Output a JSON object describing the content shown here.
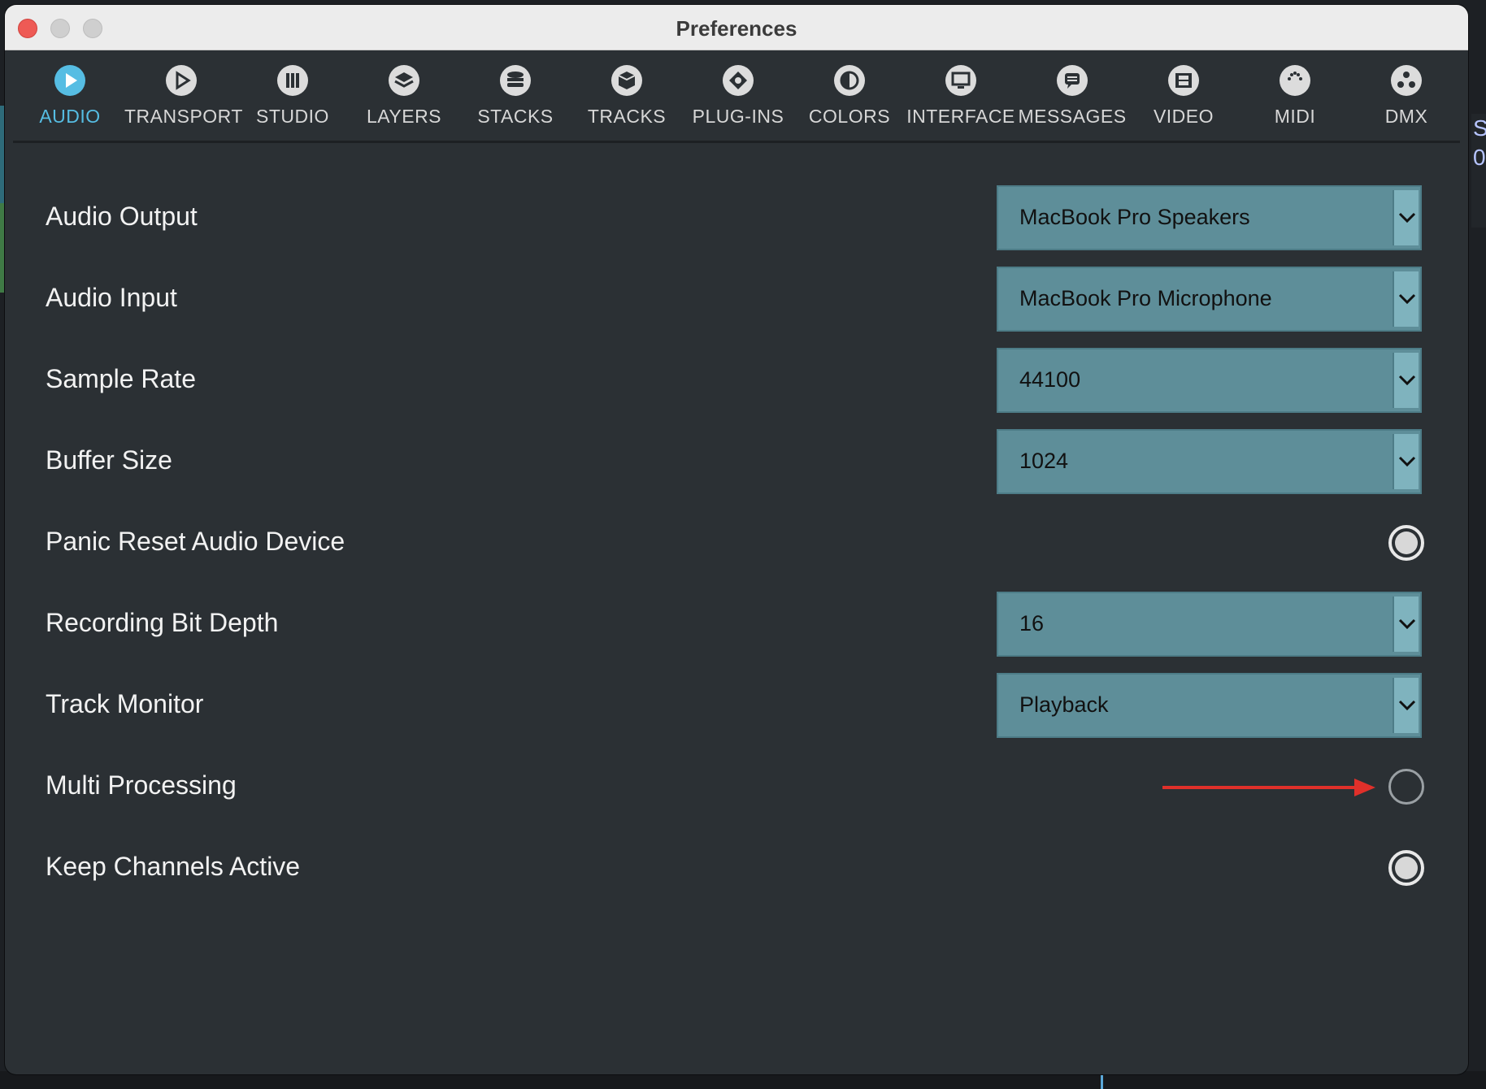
{
  "window": {
    "title": "Preferences"
  },
  "background": {
    "right_char_1": "S",
    "right_char_2": "0"
  },
  "tabs": [
    {
      "label": "AUDIO",
      "icon": "play-icon",
      "active": true
    },
    {
      "label": "TRANSPORT",
      "icon": "play-outline-icon"
    },
    {
      "label": "STUDIO",
      "icon": "piano-icon"
    },
    {
      "label": "LAYERS",
      "icon": "layers-icon"
    },
    {
      "label": "STACKS",
      "icon": "stack-icon"
    },
    {
      "label": "TRACKS",
      "icon": "cube-icon"
    },
    {
      "label": "PLUG-INS",
      "icon": "plug-icon"
    },
    {
      "label": "COLORS",
      "icon": "contrast-icon"
    },
    {
      "label": "INTERFACE",
      "icon": "monitor-icon"
    },
    {
      "label": "MESSAGES",
      "icon": "chat-icon"
    },
    {
      "label": "VIDEO",
      "icon": "film-icon"
    },
    {
      "label": "MIDI",
      "icon": "midi-icon"
    },
    {
      "label": "DMX",
      "icon": "dmx-icon"
    }
  ],
  "settings": [
    {
      "label": "Audio Output",
      "type": "select",
      "value": "MacBook Pro Speakers"
    },
    {
      "label": "Audio Input",
      "type": "select",
      "value": "MacBook Pro Microphone"
    },
    {
      "label": "Sample Rate",
      "type": "select",
      "value": "44100"
    },
    {
      "label": "Buffer Size",
      "type": "select",
      "value": "1024"
    },
    {
      "label": "Panic Reset Audio Device",
      "type": "radio",
      "checked": true
    },
    {
      "label": "Recording Bit Depth",
      "type": "select",
      "value": "16"
    },
    {
      "label": "Track Monitor",
      "type": "select",
      "value": "Playback"
    },
    {
      "label": "Multi Processing",
      "type": "radio",
      "checked": false,
      "annotation": "red-arrow-pointing-right"
    },
    {
      "label": "Keep Channels Active",
      "type": "radio",
      "checked": true
    }
  ],
  "colors": {
    "active_tab": "#56bde3",
    "select_bg": "#5e8e99",
    "arrow": "#e0302a"
  }
}
